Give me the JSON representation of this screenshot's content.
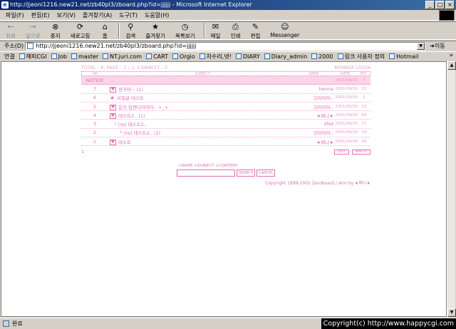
{
  "window": {
    "title": "http://jjeoni1216.new21.net/zb40pl3/zboard.php?id=jjjjjj - Microsoft Internet Explorer",
    "icon_letter": "e",
    "min_glyph": "_",
    "max_glyph": "□",
    "close_glyph": "×"
  },
  "menu": [
    "파일(F)",
    "편집(E)",
    "보기(V)",
    "즐겨찾기(A)",
    "도구(T)",
    "도움말(H)"
  ],
  "toolbar": [
    {
      "label": "뒤로",
      "icon": "back-arrow-icon",
      "glyph": "←",
      "disabled": true
    },
    {
      "label": "앞으로",
      "icon": "forward-arrow-icon",
      "glyph": "→",
      "disabled": true
    },
    {
      "label": "중지",
      "icon": "stop-icon",
      "glyph": "⊗",
      "disabled": false
    },
    {
      "label": "새로고침",
      "icon": "refresh-icon",
      "glyph": "⟳",
      "disabled": false
    },
    {
      "label": "홈",
      "icon": "home-icon",
      "glyph": "⌂",
      "disabled": false
    },
    {
      "label": "검색",
      "icon": "search-icon",
      "glyph": "⚲",
      "disabled": false
    },
    {
      "label": "즐겨찾기",
      "icon": "favorites-icon",
      "glyph": "★",
      "disabled": false
    },
    {
      "label": "목록보기",
      "icon": "history-icon",
      "glyph": "◷",
      "disabled": false
    },
    {
      "label": "메일",
      "icon": "mail-icon",
      "glyph": "✉",
      "disabled": false
    },
    {
      "label": "인쇄",
      "icon": "print-icon",
      "glyph": "⎙",
      "disabled": false
    },
    {
      "label": "편집",
      "icon": "edit-icon",
      "glyph": "✎",
      "disabled": false
    },
    {
      "label": "Messenger",
      "icon": "messenger-icon",
      "glyph": "☺",
      "disabled": false
    }
  ],
  "address": {
    "label": "주소(D)",
    "url": "http://jjeoni1216.new21.net/zb40pl3/zboard.php?id=jjjjjj",
    "dropdown_glyph": "▼",
    "go_label": "이동",
    "go_glyph": "➜"
  },
  "links": {
    "label": "연결",
    "items": [
      "해피CGI",
      "Job",
      "master",
      "NT.juri.com",
      "CART",
      "Orgio",
      "차수리,넷!",
      "DIARY",
      "Diary_admin",
      "2000",
      "링크 사용자 정의",
      "Hotmail"
    ],
    "chevron": "»"
  },
  "board": {
    "stats": "TOTAL : 8, PAGE : 1 / 1, CONNECT : 0",
    "member_login": "MEMBER LOGIN",
    "columns": {
      "no": "NO",
      "subject": "SUBJECT",
      "name": "NAME",
      "date": "DATE",
      "hit": "HIT"
    },
    "rows": [
      {
        "no": "NOTICE",
        "subject": "...",
        "name": "",
        "date": "2001/09/29",
        "hit": "7",
        "icon": "none",
        "indent": 0,
        "notice": true
      },
      {
        "no": "7",
        "subject": "정구마~ (1)",
        "name": "henna",
        "date": "2001/09/30",
        "hit": "15",
        "icon": "heart",
        "indent": 0,
        "notice": false
      },
      {
        "no": "6",
        "subject": "비밀글 테스트",
        "name": "끄아아아::",
        "date": "2001/09/30",
        "hit": "2",
        "icon": "star",
        "indent": 0,
        "notice": false
      },
      {
        "no": "5",
        "subject": "음지 업캔다아아아.. +_+",
        "name": "끄아아아::",
        "date": "2001/09/30",
        "hit": "13",
        "icon": "heart",
        "indent": 0,
        "notice": false
      },
      {
        "no": "4",
        "subject": "테스트2.. (1)",
        "name": "★쩌니★",
        "date": "2001/09/29",
        "hit": "64",
        "icon": "heart",
        "indent": 0,
        "notice": false
      },
      {
        "no": "3",
        "subject": "[re] 테스트2..",
        "name": "sfsd",
        "date": "2001/09/29",
        "hit": "17",
        "icon": "reply",
        "indent": 1,
        "notice": false
      },
      {
        "no": "2",
        "subject": "[re] 테스트2.. (2)",
        "name": "끄아아아::",
        "date": "2001/09/29",
        "hit": "24",
        "icon": "reply",
        "indent": 2,
        "notice": false
      },
      {
        "no": "1",
        "subject": "테스트",
        "name": "★쩌니★",
        "date": "2001/09/29",
        "hit": "29",
        "icon": "heart",
        "indent": 0,
        "notice": false
      }
    ],
    "page_num": "1",
    "list_button": "LIST",
    "write_button": "WRITE",
    "search_options": "+NAME +SUBJECT +CONTENT",
    "search_value": "",
    "search_button": "SEARCH",
    "cancel_button": "CANCEL",
    "copyright": "Copyright 1999-2001 Zeroboard / skin by ★쩌니★"
  },
  "status": {
    "text": "완료",
    "watermark": "Copyright(c) http://www.happycgi.com"
  }
}
